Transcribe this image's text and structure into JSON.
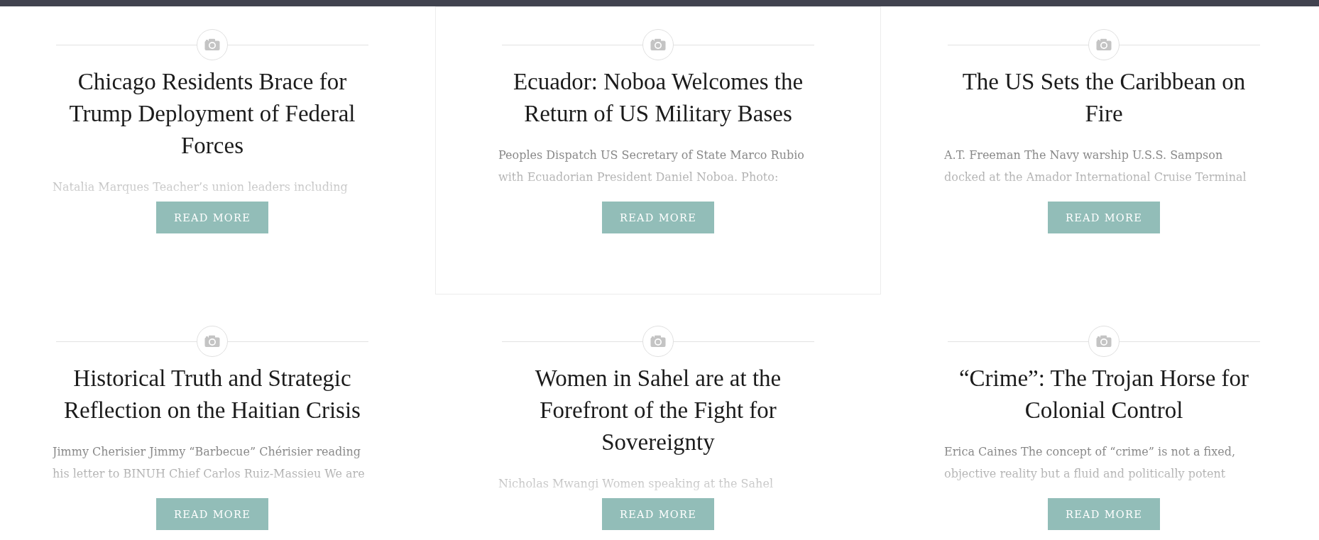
{
  "articles": [
    {
      "title": "Chicago Residents Brace for Trump Deployment of Federal Forces",
      "excerpt": "Natalia Marques Teacher’s union leaders including",
      "button": "READ MORE",
      "hovered": false
    },
    {
      "title": "Ecuador: Noboa Welcomes the Return of US Military Bases",
      "excerpt": "Peoples Dispatch US Secretary of State Marco Rubio with Ecuadorian President Daniel Noboa. Photo:",
      "button": "READ MORE",
      "hovered": true
    },
    {
      "title": "The US Sets the Caribbean on Fire",
      "excerpt": "A.T. Freeman The Navy warship U.S.S. Sampson docked at the Amador International Cruise Terminal",
      "button": "READ MORE",
      "hovered": false
    },
    {
      "title": "Historical Truth and Strategic Reflection on the Haitian Crisis",
      "excerpt": "Jimmy Cherisier Jimmy “Barbecue” Chérisier reading his letter to BINUH Chief Carlos Ruiz-Massieu We are",
      "button": "READ MORE",
      "hovered": false
    },
    {
      "title": "Women in Sahel are at the Forefront of the Fight for Sovereignty",
      "excerpt": "Nicholas Mwangi Women speaking at the Sahel",
      "button": "READ MORE",
      "hovered": false
    },
    {
      "title": "“Crime”: The Trojan Horse for Colonial Control",
      "excerpt": "Erica Caines The concept of “crime” is not a fixed, objective reality but a fluid and politically potent",
      "button": "READ MORE",
      "hovered": false
    }
  ]
}
